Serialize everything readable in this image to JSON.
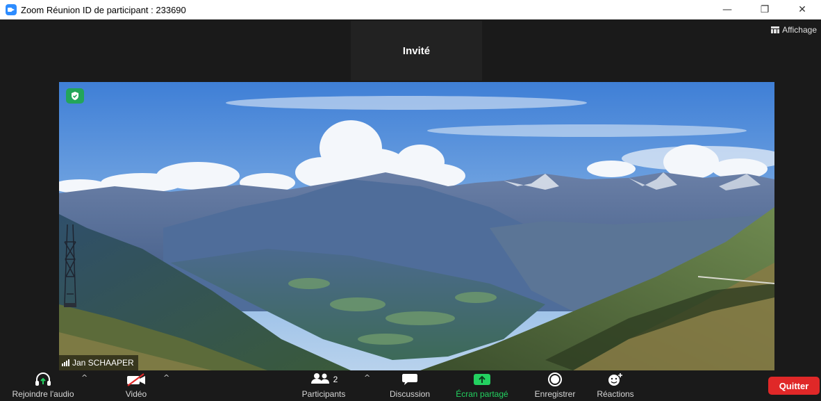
{
  "window": {
    "title": "Zoom Réunion ID de participant : 233690",
    "controls": {
      "minimize": "—",
      "restore": "❐",
      "close": "✕"
    }
  },
  "top_right": {
    "view_label": "Affichage"
  },
  "guest": {
    "label": "Invité"
  },
  "video": {
    "participant_name": "Jan SCHAAPER"
  },
  "toolbar": {
    "join_audio": "Rejoindre l'audio",
    "video": "Vidéo",
    "participants": "Participants",
    "participants_count": "2",
    "chat": "Discussion",
    "share_screen": "Écran partagé",
    "record": "Enregistrer",
    "reactions": "Réactions",
    "leave": "Quitter",
    "caret": "^"
  },
  "colors": {
    "accent_green": "#23d160",
    "leave_red": "#e02828",
    "brand_blue": "#2d8cff"
  }
}
